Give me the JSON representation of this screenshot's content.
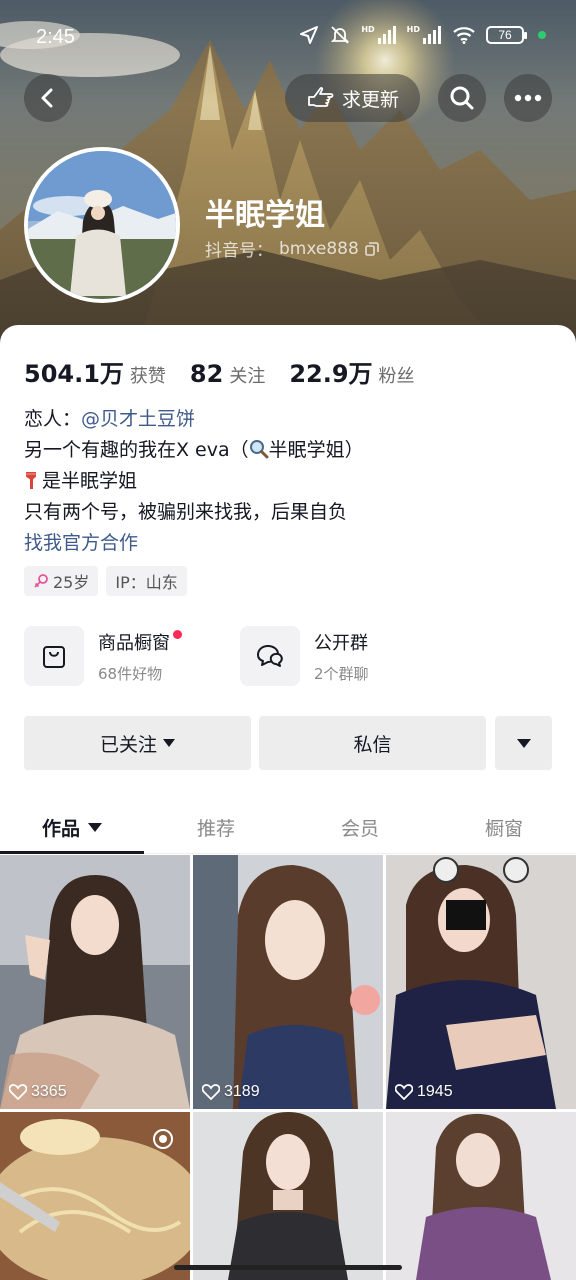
{
  "status_bar": {
    "time": "2:45",
    "hd_left": "HD",
    "hd_right": "HD",
    "battery": "76"
  },
  "header": {
    "update_label": "求更新"
  },
  "profile": {
    "name": "半眠学姐",
    "id_prefix": "抖音号：",
    "id_value": "bmxe888"
  },
  "stats": [
    {
      "num": "504.1万",
      "label": "获赞"
    },
    {
      "num": "82",
      "label": "关注"
    },
    {
      "num": "22.9万",
      "label": "粉丝"
    }
  ],
  "bio": {
    "partner_prefix": "恋人：",
    "partner_link": "@贝才土豆饼",
    "line2_a": "另一个有趣的我在X eva（",
    "line2_b": "半眠学姐）",
    "line3": "是半眠学姐",
    "line4": "只有两个号，被骗别来找我，后果自负",
    "line5": "找我官方合作"
  },
  "tags": {
    "age": "25岁",
    "ip": "IP：山东"
  },
  "services": {
    "shop_title": "商品橱窗",
    "shop_sub": "68件好物",
    "group_title": "公开群",
    "group_sub": "2个群聊"
  },
  "actions": {
    "followed": "已关注",
    "message": "私信"
  },
  "tabs": [
    "作品",
    "推荐",
    "会员",
    "橱窗"
  ],
  "videos": [
    {
      "likes": "3365"
    },
    {
      "likes": "3189"
    },
    {
      "likes": "1945"
    }
  ],
  "colors": {
    "accent_red": "#fe2c55",
    "link_blue": "#3f5b8c",
    "gender_pink": "#e0589a"
  }
}
